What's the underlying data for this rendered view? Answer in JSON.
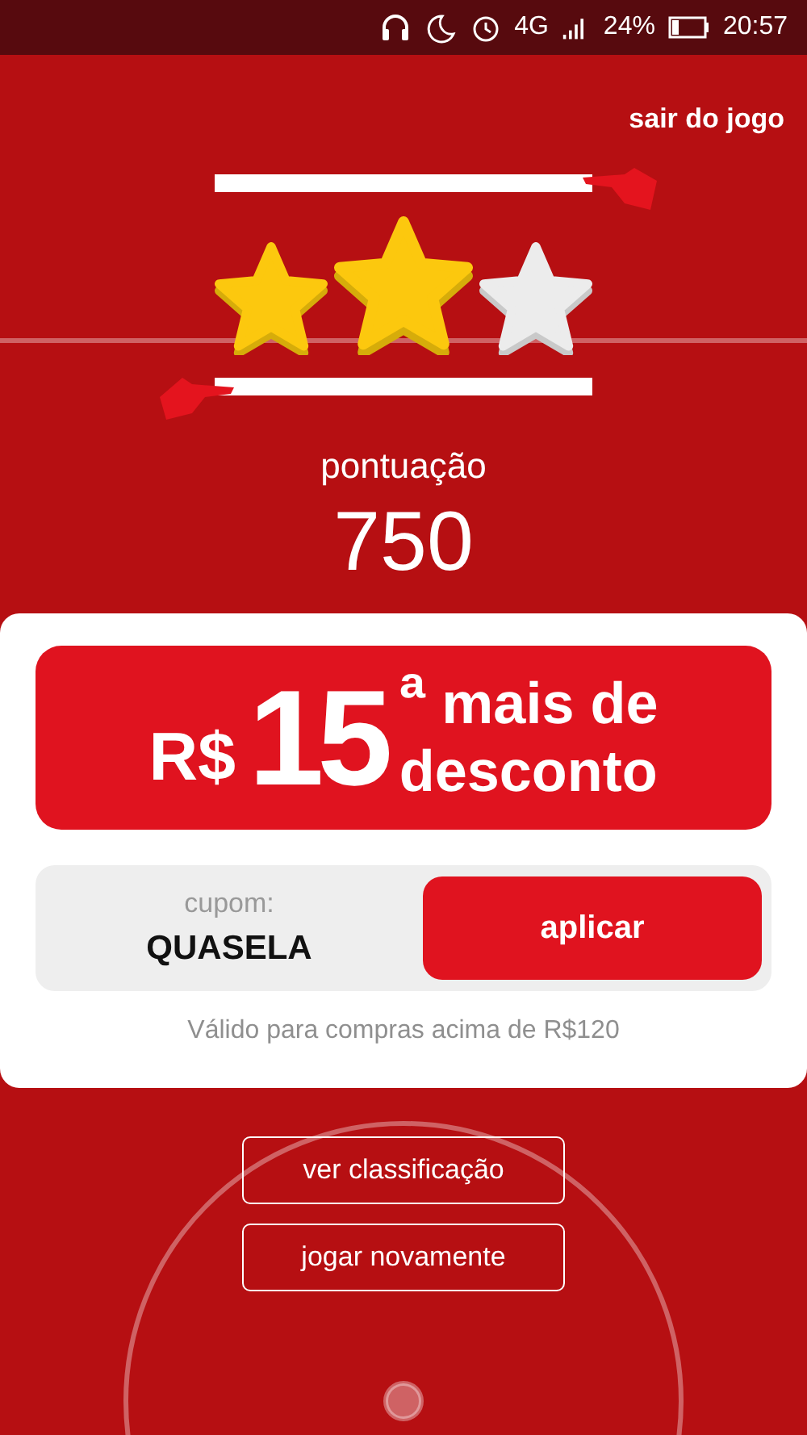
{
  "status_bar": {
    "network": "4G",
    "battery": "24%",
    "time": "20:57"
  },
  "exit_link": "sair do jogo",
  "stars": 2,
  "score_label": "pontuação",
  "score": "750",
  "promo": {
    "currency": "R$",
    "amount": "15",
    "ordinal": "ª",
    "line_1": "mais de",
    "line_2": "desconto"
  },
  "coupon": {
    "label": "cupom:",
    "code": "QUASELA",
    "button": "aplicar"
  },
  "note": "Válido para compras acima de R$120",
  "buttons": [
    "ver classificação",
    "jogar novamente"
  ]
}
